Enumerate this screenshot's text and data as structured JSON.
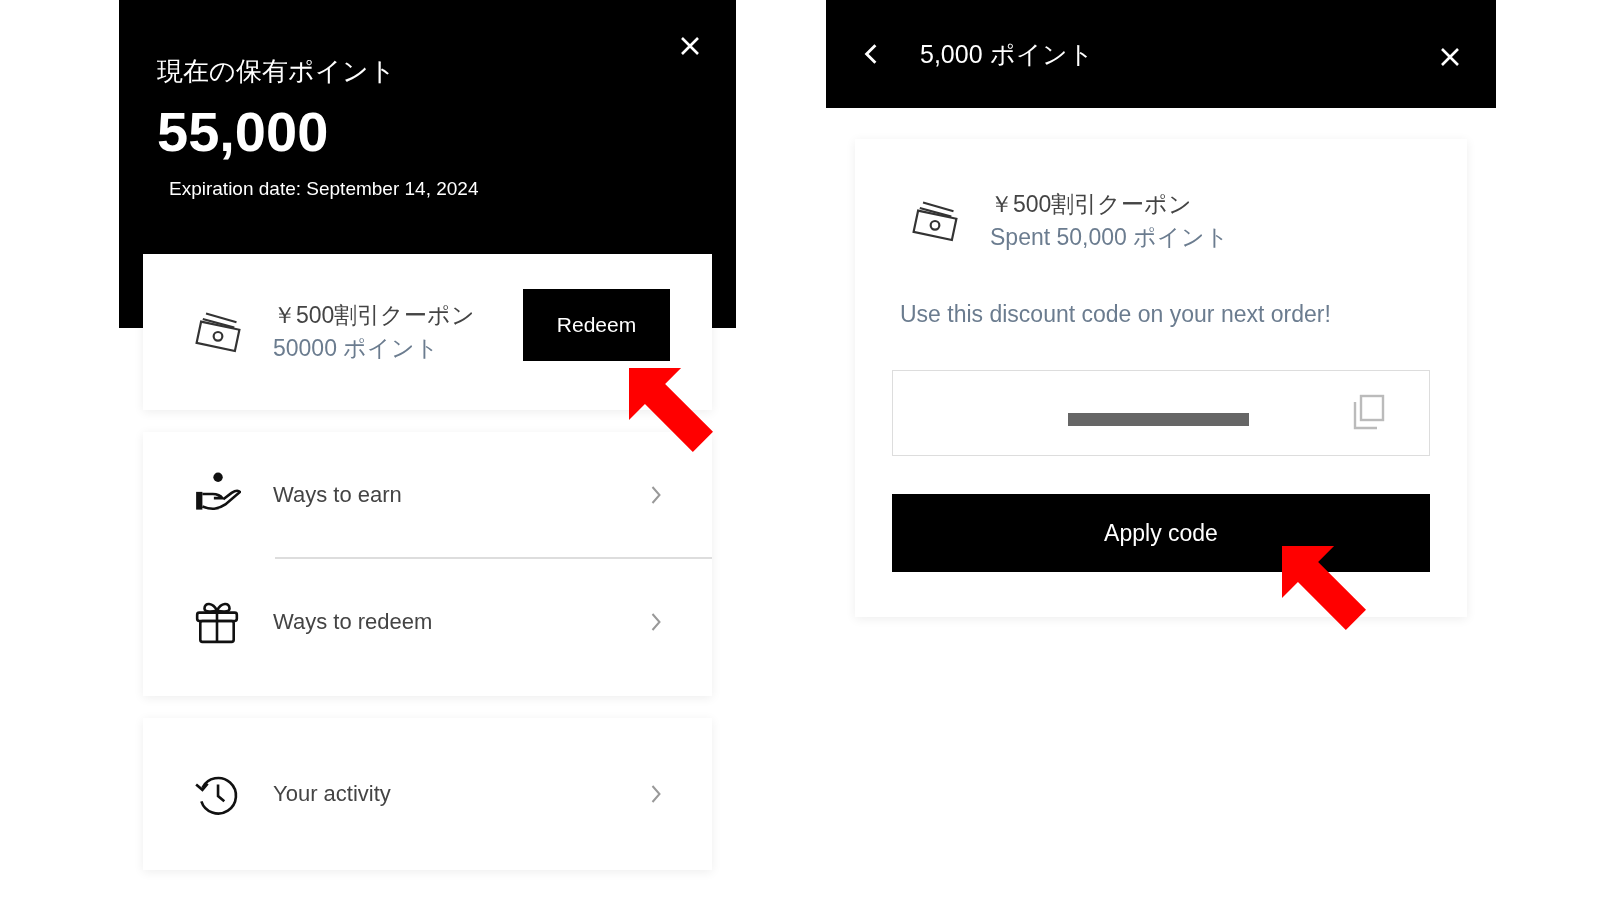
{
  "left_panel": {
    "title": "現在の保有ポイント",
    "balance": "55,000",
    "expiration": "Expiration date: September 14, 2024",
    "coupon": {
      "name": "￥500割引クーポン",
      "cost": "50000 ポイント",
      "button": "Redeem"
    },
    "menu_groups": [
      {
        "items": [
          {
            "label": "Ways to earn",
            "kind": "earn"
          },
          {
            "label": "Ways to redeem",
            "kind": "redeem"
          }
        ]
      },
      {
        "items": [
          {
            "label": "Your activity",
            "kind": "activity"
          }
        ]
      }
    ]
  },
  "right_panel": {
    "title": "5,000 ポイント",
    "coupon": {
      "name": "￥500割引クーポン",
      "spent": "Spent 50,000 ポイント"
    },
    "message": "Use this discount code on your next order!",
    "button": "Apply code"
  }
}
